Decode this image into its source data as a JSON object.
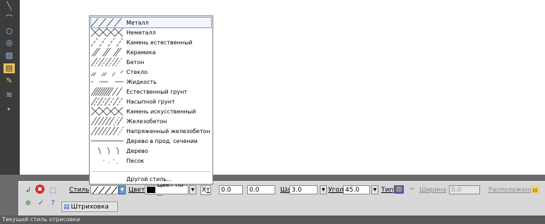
{
  "style_menu": {
    "items": [
      {
        "label": "Металл",
        "icon": "hatch-metal-swatch"
      },
      {
        "label": "Неметалл",
        "icon": "hatch-nonmetal-swatch"
      },
      {
        "label": "Камень естественный",
        "icon": "hatch-natural-stone-swatch"
      },
      {
        "label": "Керамика",
        "icon": "hatch-ceramic-swatch"
      },
      {
        "label": "Бетон",
        "icon": "hatch-concrete-swatch"
      },
      {
        "label": "Стекло",
        "icon": "hatch-glass-swatch"
      },
      {
        "label": "Жидкость",
        "icon": "hatch-liquid-swatch"
      },
      {
        "label": "Естественный грунт",
        "icon": "hatch-natural-soil-swatch"
      },
      {
        "label": "Насыпной грунт",
        "icon": "hatch-bulk-soil-swatch"
      },
      {
        "label": "Камень искусственный",
        "icon": "hatch-artificial-stone-swatch"
      },
      {
        "label": "Железобетон",
        "icon": "hatch-reinforced-concrete-swatch"
      },
      {
        "label": "Напряженный железобетон",
        "icon": "hatch-prestressed-concrete-swatch"
      },
      {
        "label": "Дерево в прод. сечении",
        "icon": "hatch-wood-long-section-swatch"
      },
      {
        "label": "Дерево",
        "icon": "hatch-wood-swatch"
      },
      {
        "label": "Песок",
        "icon": "hatch-sand-swatch"
      }
    ],
    "other_style_label": "Другой стиль..."
  },
  "props": {
    "style_label": "Стиль",
    "color_label": "Цвет",
    "color_value": "Цвет по ...",
    "color_swatch": "#000000",
    "x_label": "X",
    "x_subscript": "т",
    "x_value": "0.0",
    "y_value": "0.0",
    "step_label": "Шаг",
    "step_value": "3.0",
    "angle_label": "Угол",
    "angle_value": "45.0",
    "type_label": "Тип",
    "width_label": "Ширина",
    "width_value": "0.0",
    "placement_label": "Расположение"
  },
  "tab": {
    "label": "Штриховка"
  },
  "status": {
    "text": "Текущий стиль отрисовки"
  },
  "colors": {
    "selected_outline": "#6e9bd6",
    "panel_bg": "#d8d8d8",
    "dark_frame": "#3c3c3c"
  }
}
